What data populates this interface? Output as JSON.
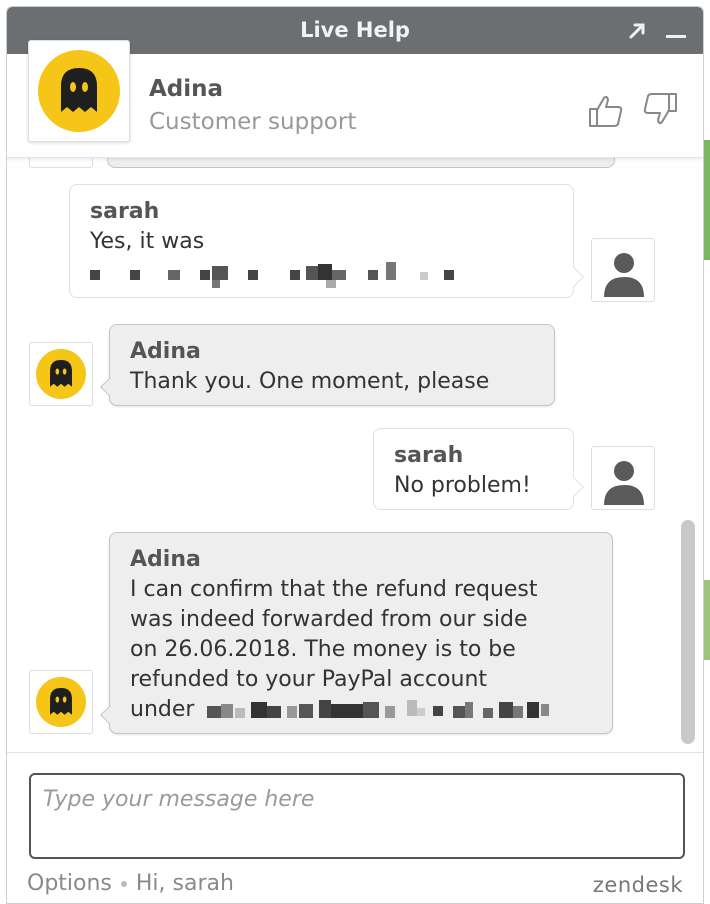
{
  "window": {
    "title": "Live Help",
    "popout_icon": "popout-arrow-icon",
    "minimize_icon": "minimize-icon"
  },
  "agent": {
    "name": "Adina",
    "role": "Customer support",
    "avatar_icon": "ghost-logo-icon",
    "brand_color": "#f5c518"
  },
  "rating": {
    "up_icon": "thumbs-up-icon",
    "down_icon": "thumbs-down-icon"
  },
  "messages": [
    {
      "sender": "sarah",
      "type": "user",
      "lines": [
        "Yes, it was"
      ],
      "redacted": true
    },
    {
      "sender": "Adina",
      "type": "agent",
      "lines": [
        "Thank you. One moment, please"
      ]
    },
    {
      "sender": "sarah",
      "type": "user",
      "lines": [
        "No problem!"
      ]
    },
    {
      "sender": "Adina",
      "type": "agent",
      "lines": [
        "I can confirm that the refund request",
        "was indeed forwarded from our side",
        "on 26.06.2018. The money is to be",
        "refunded to your PayPal account",
        "under"
      ],
      "redacted": true
    }
  ],
  "composer": {
    "placeholder": "Type your message here",
    "value": ""
  },
  "footer": {
    "options_label": "Options",
    "greeting": "Hi, sarah",
    "brand": "zendesk"
  },
  "colors": {
    "titlebar": "#6c6f71",
    "agent_bubble": "#eeeeee",
    "user_bubble": "#ffffff"
  }
}
